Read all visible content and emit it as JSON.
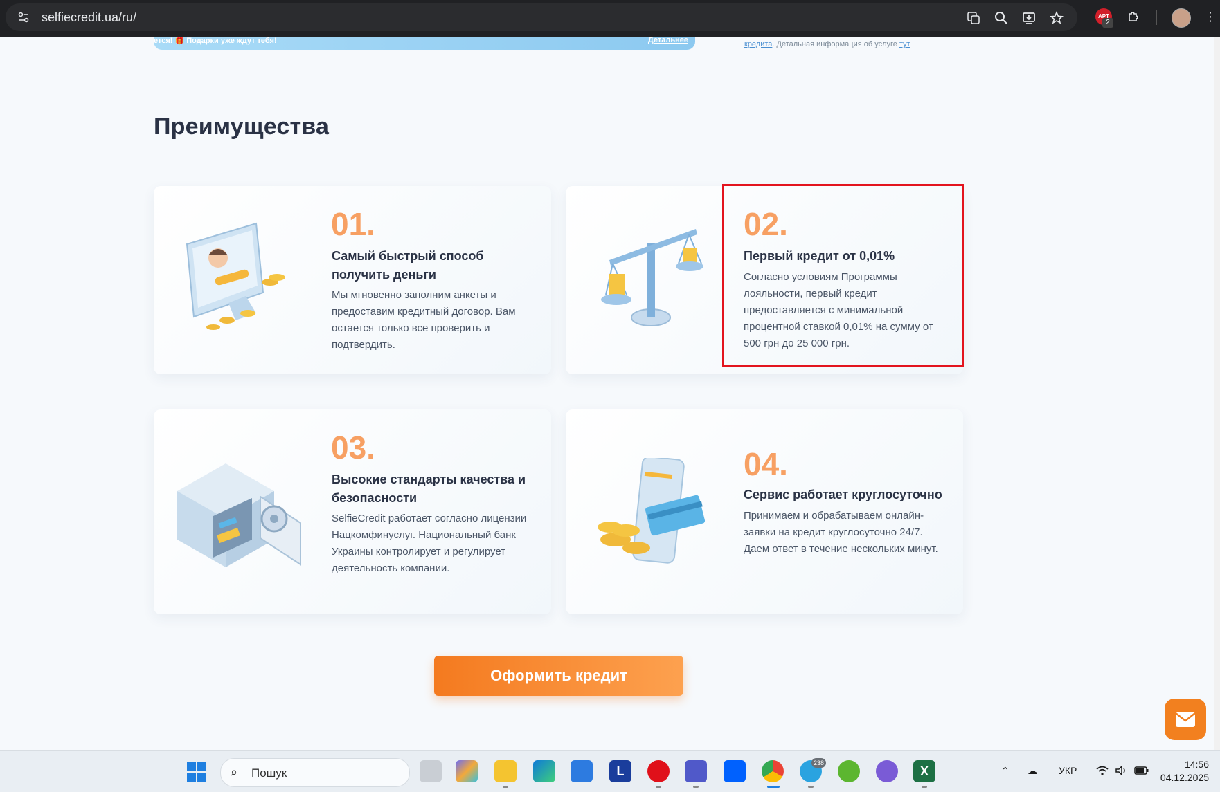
{
  "browser": {
    "url": "selfiecredit.ua/ru/",
    "extension_badge": "2",
    "extension_label": "APT"
  },
  "banner": {
    "text": "ется! 🎁 Подарки уже ждут тебя!",
    "link": "Детальнее"
  },
  "top_note": {
    "link1": "кредита",
    "text": ". Детальная информация об услуге ",
    "link2": "тут"
  },
  "section": {
    "title": "Преимущества"
  },
  "cards": [
    {
      "num": "01.",
      "title": "Самый быстрый способ получить деньги",
      "desc": "Мы мгновенно заполним анкеты и предоставим кредитный договор. Вам остается только все проверить и подтвердить."
    },
    {
      "num": "02.",
      "title": "Первый кредит от 0,01%",
      "desc": "Согласно условиям Программы лояльности, первый кредит предоставляется с минимальной процентной ставкой 0,01% на сумму от 500 грн до 25 000 грн."
    },
    {
      "num": "03.",
      "title": "Высокие стандарты качества и безопасности",
      "desc": "SelfieCredit работает согласно лицензии Нацкомфинуслуг. Национальный банк Украины контролирует и регулирует деятельность компании."
    },
    {
      "num": "04.",
      "title": "Сервис работает круглосуточно",
      "desc": "Принимаем и обрабатываем онлайн-заявки на кредит круглосуточно 24/7. Даем ответ в течение нескольких минут."
    }
  ],
  "cta": {
    "label": "Оформить кредит"
  },
  "taskbar": {
    "search_placeholder": "Пошук",
    "language": "УКР",
    "time": "14:56",
    "date": "04.12.2025",
    "telegram_badge": "238"
  },
  "colors": {
    "accent_orange": "#f47a1f",
    "number_orange": "#f7a063",
    "highlight_red": "#e3141e"
  }
}
